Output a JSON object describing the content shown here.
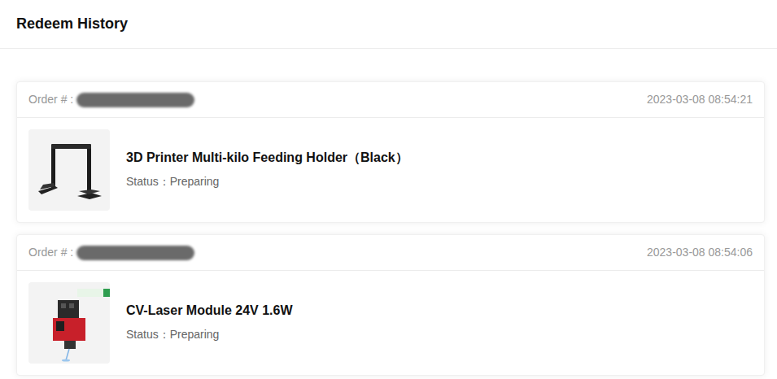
{
  "page": {
    "title": "Redeem History"
  },
  "orders": [
    {
      "order_label": "Order # :",
      "time": "2023-03-08 08:54:21",
      "product": "3D Printer Multi-kilo Feeding Holder（Black）",
      "status_label": "Status：",
      "status": "Preparing",
      "kind": "holder"
    },
    {
      "order_label": "Order # :",
      "time": "2023-03-08 08:54:06",
      "product": "CV-Laser Module 24V 1.6W",
      "status_label": "Status：",
      "status": "Preparing",
      "kind": "laser"
    }
  ]
}
